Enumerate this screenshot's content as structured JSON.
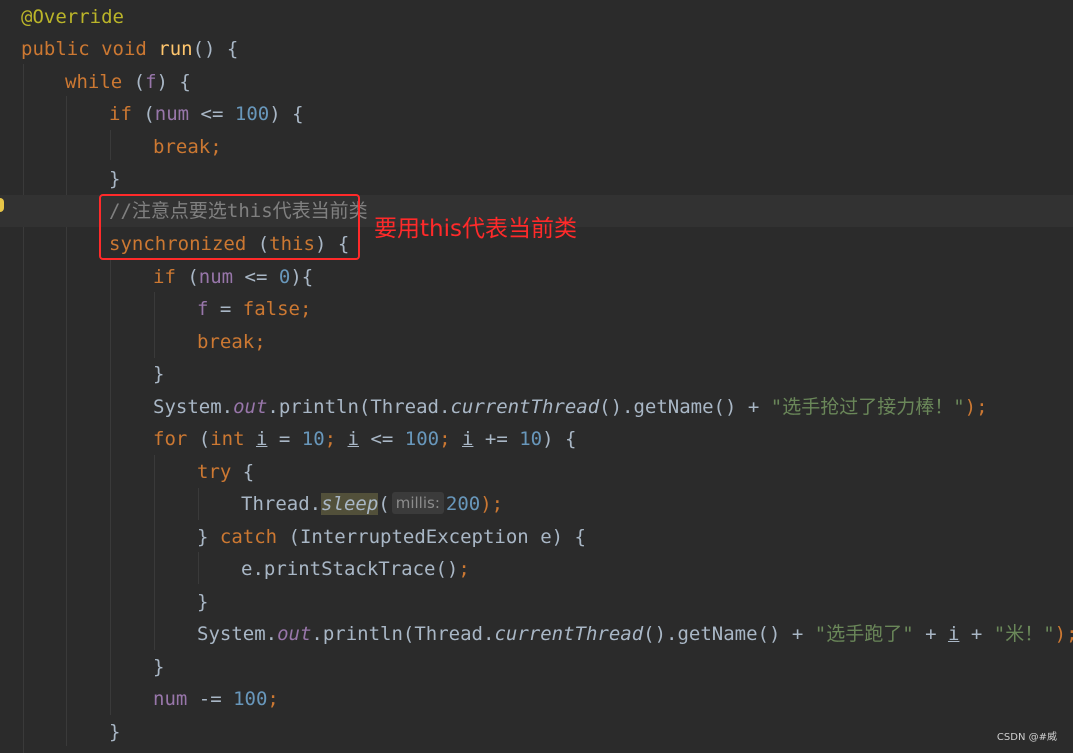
{
  "editor": {
    "lines": [
      {
        "tokens": [
          {
            "t": "@Override",
            "c": "c-ann"
          }
        ]
      },
      {
        "tokens": [
          {
            "t": "public void ",
            "c": "c-kw"
          },
          {
            "t": "run",
            "c": "c-fn"
          },
          {
            "t": "() {",
            "c": "c-id"
          }
        ]
      },
      {
        "tokens": [
          {
            "t": "while ",
            "c": "c-kw"
          },
          {
            "t": "(",
            "c": "c-id"
          },
          {
            "t": "f",
            "c": "c-fld"
          },
          {
            "t": ") {",
            "c": "c-id"
          }
        ]
      },
      {
        "tokens": [
          {
            "t": "if ",
            "c": "c-kw"
          },
          {
            "t": "(",
            "c": "c-id"
          },
          {
            "t": "num",
            "c": "c-fld"
          },
          {
            "t": " <= ",
            "c": "c-id"
          },
          {
            "t": "100",
            "c": "c-num"
          },
          {
            "t": ") {",
            "c": "c-id"
          }
        ]
      },
      {
        "tokens": [
          {
            "t": "break;",
            "c": "c-kw"
          }
        ]
      },
      {
        "tokens": [
          {
            "t": "}",
            "c": "c-id"
          }
        ]
      },
      {
        "tokens": [
          {
            "t": "//注意点要选this代表当前类",
            "c": "c-cmt"
          }
        ]
      },
      {
        "tokens": [
          {
            "t": "synchronized ",
            "c": "c-kw"
          },
          {
            "t": "(",
            "c": "c-id"
          },
          {
            "t": "this",
            "c": "c-kw"
          },
          {
            "t": ") {",
            "c": "c-id"
          }
        ]
      },
      {
        "tokens": [
          {
            "t": "if ",
            "c": "c-kw"
          },
          {
            "t": "(",
            "c": "c-id"
          },
          {
            "t": "num",
            "c": "c-fld"
          },
          {
            "t": " <= ",
            "c": "c-id"
          },
          {
            "t": "0",
            "c": "c-num"
          },
          {
            "t": "){",
            "c": "c-id"
          }
        ]
      },
      {
        "tokens": [
          {
            "t": "f",
            "c": "c-fld"
          },
          {
            "t": " = ",
            "c": "c-id"
          },
          {
            "t": "false;",
            "c": "c-kw"
          }
        ]
      },
      {
        "tokens": [
          {
            "t": "break;",
            "c": "c-kw"
          }
        ]
      },
      {
        "tokens": [
          {
            "t": "}",
            "c": "c-id"
          }
        ]
      },
      {
        "tokens": [
          {
            "t": "System.",
            "c": "c-id"
          },
          {
            "t": "out",
            "c": "c-fld it"
          },
          {
            "t": ".println(Thread.",
            "c": "c-id"
          },
          {
            "t": "currentThread",
            "c": "c-id it"
          },
          {
            "t": "().getName() + ",
            "c": "c-id"
          },
          {
            "t": "\"选手抢过了接力棒！\"",
            "c": "c-str"
          },
          {
            "t": ");",
            "c": "c-kw"
          }
        ]
      },
      {
        "tokens": [
          {
            "t": "for ",
            "c": "c-kw"
          },
          {
            "t": "(",
            "c": "c-id"
          },
          {
            "t": "int ",
            "c": "c-kw"
          },
          {
            "t": "i",
            "c": "c-id ul"
          },
          {
            "t": " = ",
            "c": "c-id"
          },
          {
            "t": "10",
            "c": "c-num"
          },
          {
            "t": "; ",
            "c": "c-kw"
          },
          {
            "t": "i",
            "c": "c-id ul"
          },
          {
            "t": " <= ",
            "c": "c-id"
          },
          {
            "t": "100",
            "c": "c-num"
          },
          {
            "t": "; ",
            "c": "c-kw"
          },
          {
            "t": "i",
            "c": "c-id ul"
          },
          {
            "t": " += ",
            "c": "c-id"
          },
          {
            "t": "10",
            "c": "c-num"
          },
          {
            "t": ") {",
            "c": "c-id"
          }
        ]
      },
      {
        "tokens": [
          {
            "t": "try ",
            "c": "c-kw"
          },
          {
            "t": "{",
            "c": "c-id"
          }
        ]
      },
      {
        "tokens": [
          {
            "t": "Thread.",
            "c": "c-id"
          },
          {
            "t": "sleep",
            "c": "c-id it sleep-bg"
          },
          {
            "t": "(",
            "c": "c-id"
          },
          {
            "t": "millis:",
            "c": "hint"
          },
          {
            "t": "200",
            "c": "c-num"
          },
          {
            "t": ");",
            "c": "c-kw"
          }
        ]
      },
      {
        "tokens": [
          {
            "t": "} ",
            "c": "c-id"
          },
          {
            "t": "catch ",
            "c": "c-kw"
          },
          {
            "t": "(InterruptedException e) {",
            "c": "c-id"
          }
        ]
      },
      {
        "tokens": [
          {
            "t": "e.printStackTrace()",
            "c": "c-id"
          },
          {
            "t": ";",
            "c": "c-kw"
          }
        ]
      },
      {
        "tokens": [
          {
            "t": "}",
            "c": "c-id"
          }
        ]
      },
      {
        "tokens": [
          {
            "t": "System.",
            "c": "c-id"
          },
          {
            "t": "out",
            "c": "c-fld it"
          },
          {
            "t": ".println(Thread.",
            "c": "c-id"
          },
          {
            "t": "currentThread",
            "c": "c-id it"
          },
          {
            "t": "().getName() + ",
            "c": "c-id"
          },
          {
            "t": "\"选手跑了\"",
            "c": "c-str"
          },
          {
            "t": " + ",
            "c": "c-id"
          },
          {
            "t": "i",
            "c": "c-id ul"
          },
          {
            "t": " + ",
            "c": "c-id"
          },
          {
            "t": "\"米！\"",
            "c": "c-str"
          },
          {
            "t": ");",
            "c": "c-kw"
          }
        ]
      },
      {
        "tokens": [
          {
            "t": "}",
            "c": "c-id"
          }
        ]
      },
      {
        "tokens": [
          {
            "t": "num",
            "c": "c-fld"
          },
          {
            "t": " -= ",
            "c": "c-id"
          },
          {
            "t": "100",
            "c": "c-num"
          },
          {
            "t": ";",
            "c": "c-kw"
          }
        ]
      },
      {
        "tokens": [
          {
            "t": "}",
            "c": "c-id"
          }
        ]
      }
    ]
  },
  "callout": {
    "text": "要用this代表当前类"
  },
  "watermark": {
    "text": "CSDN @#威"
  }
}
